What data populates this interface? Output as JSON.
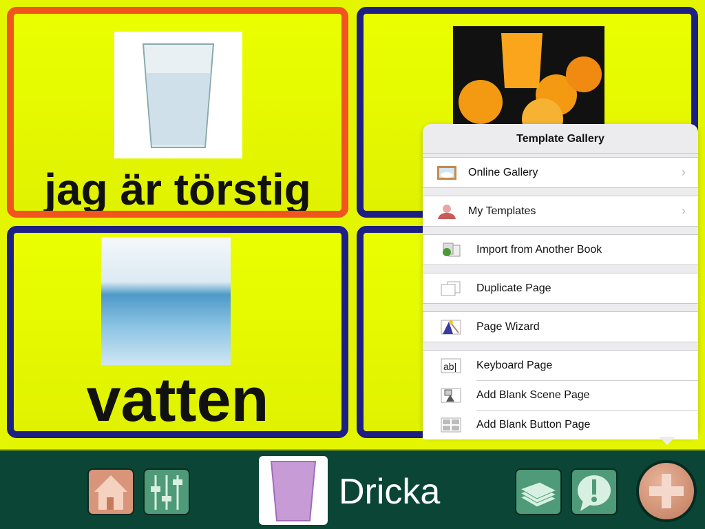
{
  "cards": [
    {
      "label": "jag är törstig",
      "image": "glass-of-water",
      "selected": true
    },
    {
      "label": "",
      "image": "orange-juice"
    },
    {
      "label": "vatten",
      "image": "water-splash"
    },
    {
      "label": "",
      "image": ""
    }
  ],
  "popover": {
    "title": "Template Gallery",
    "groups": [
      [
        {
          "label": "Online Gallery",
          "icon": "cloud-frame-icon",
          "chevron": true
        }
      ],
      [
        {
          "label": "My Templates",
          "icon": "person-icon",
          "chevron": true
        }
      ],
      [
        {
          "label": "Import from Another Book",
          "icon": "import-icon"
        }
      ],
      [
        {
          "label": "Duplicate Page",
          "icon": "duplicate-icon"
        }
      ],
      [
        {
          "label": "Page Wizard",
          "icon": "wizard-icon"
        }
      ],
      [
        {
          "label": "Keyboard Page",
          "icon": "keyboard-ab-icon"
        },
        {
          "label": "Add Blank Scene Page",
          "icon": "scene-icon"
        },
        {
          "label": "Add Blank Button Page",
          "icon": "grid-icon"
        }
      ]
    ]
  },
  "toolbar": {
    "page_title": "Dricka",
    "buttons": [
      "home",
      "settings",
      "pages",
      "alert",
      "add"
    ],
    "colors": {
      "bar": "#0b4536",
      "accent": "#d9957a"
    }
  }
}
